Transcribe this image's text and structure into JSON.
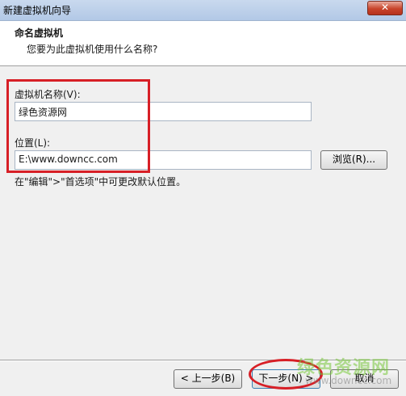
{
  "window": {
    "title": "新建虚拟机向导",
    "close_glyph": "✕"
  },
  "header": {
    "title": "命名虚拟机",
    "subtitle": "您要为此虚拟机使用什么名称?"
  },
  "form": {
    "name_label": "虚拟机名称(V):",
    "name_value": "绿色资源网",
    "location_label": "位置(L):",
    "location_value": "E:\\www.downcc.com",
    "browse_label": "浏览(R)...",
    "hint": "在\"编辑\">\"首选项\"中可更改默认位置。"
  },
  "footer": {
    "back_label": "< 上一步(B)",
    "next_label": "下一步(N) >",
    "cancel_label": "取消"
  },
  "watermark": {
    "main": "绿色资源网",
    "sub": "www.downcc.com"
  },
  "colors": {
    "annotation": "#d71f26",
    "header_bg": "#ffffff",
    "body_bg": "#f0f0f0"
  }
}
